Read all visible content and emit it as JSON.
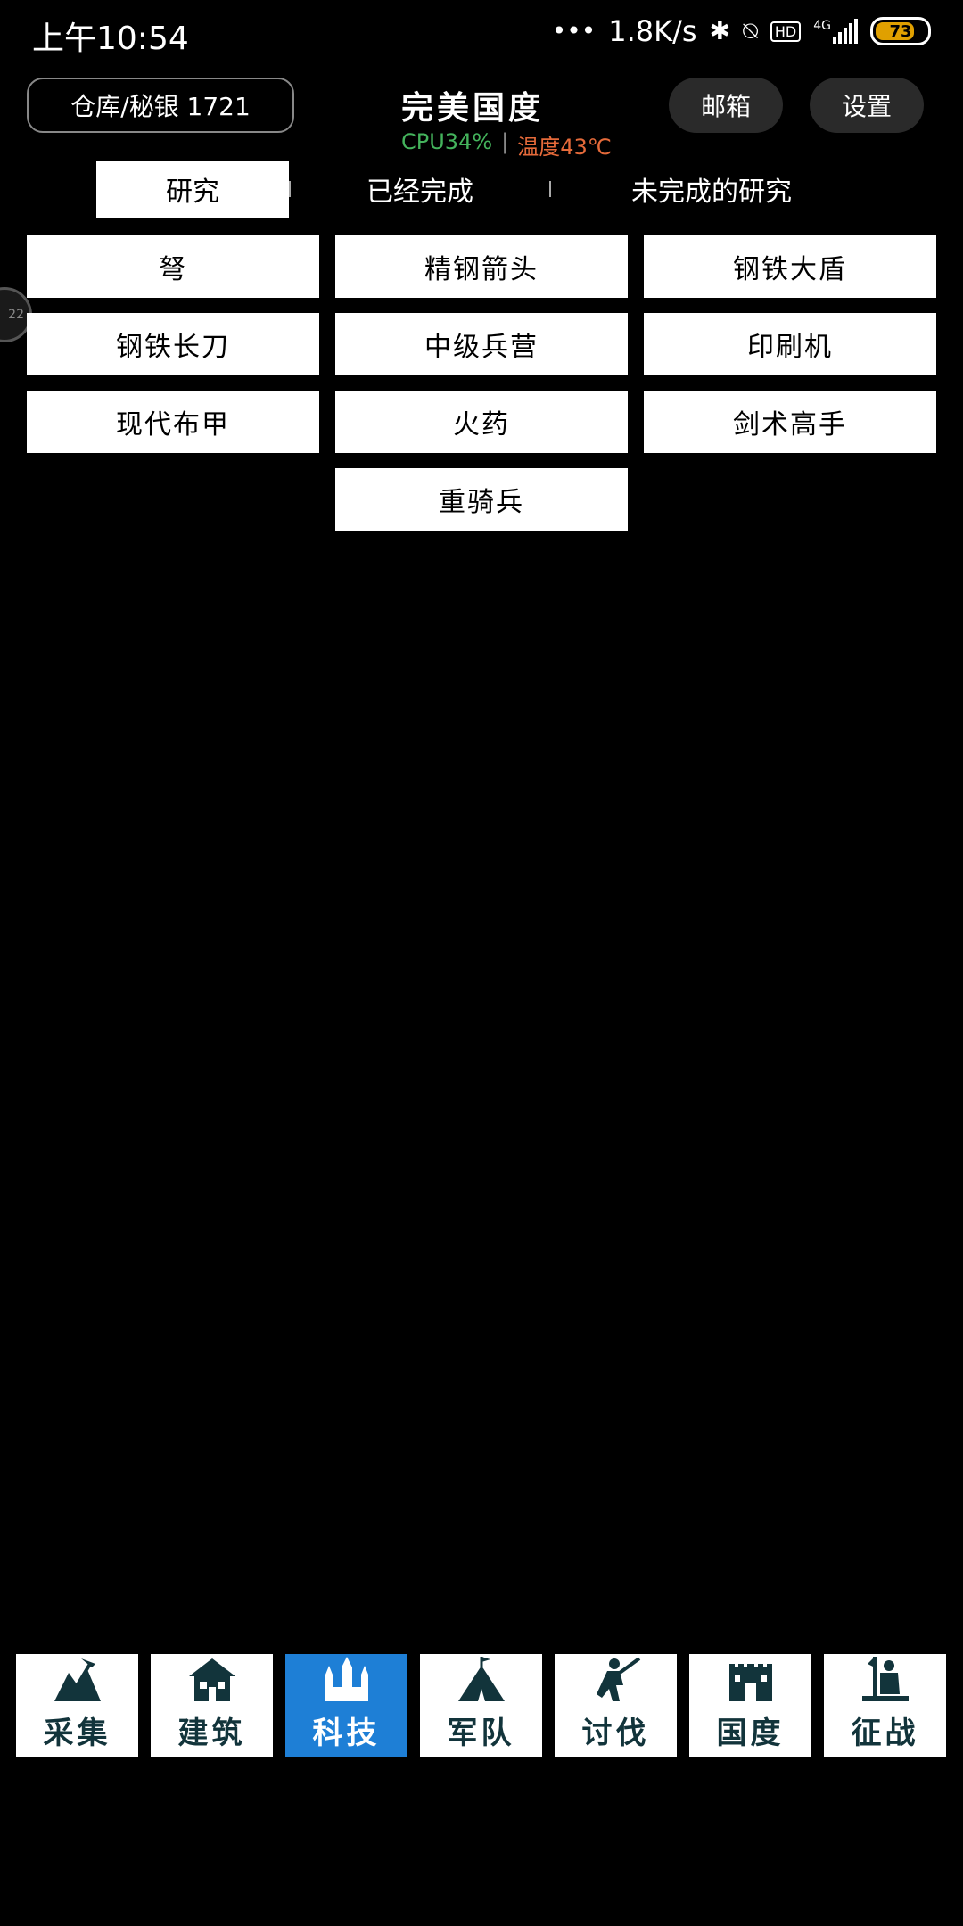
{
  "status_bar": {
    "time": "上午10:54",
    "net_speed": "1.8K/s",
    "signal_type": "4G",
    "battery": "73",
    "hd_badge": "HD"
  },
  "header": {
    "storage_label": "仓库/秘银 1721",
    "title": "完美国度",
    "cpu": "CPU34%",
    "separator": "|",
    "temperature": "温度43℃",
    "mail_label": "邮箱",
    "settings_label": "设置"
  },
  "floating_ball": {
    "text": "22"
  },
  "tabs": {
    "research": "研究",
    "completed": "已经完成",
    "unfinished": "未完成的研究"
  },
  "research_items": [
    "弩",
    "精钢箭头",
    "钢铁大盾",
    "钢铁长刀",
    "中级兵营",
    "印刷机",
    "现代布甲",
    "火药",
    "剑术高手",
    "重骑兵"
  ],
  "bottom_nav": {
    "items": [
      {
        "label": "采集",
        "icon": "gather-icon"
      },
      {
        "label": "建筑",
        "icon": "building-icon"
      },
      {
        "label": "科技",
        "icon": "tech-icon"
      },
      {
        "label": "军队",
        "icon": "army-icon"
      },
      {
        "label": "讨伐",
        "icon": "crusade-icon"
      },
      {
        "label": "国度",
        "icon": "kingdom-icon"
      },
      {
        "label": "征战",
        "icon": "conquest-icon"
      }
    ],
    "active_index": 2
  },
  "colors": {
    "background": "#000000",
    "cpu": "#44b35c",
    "temperature": "#e56a3a",
    "nav_active": "#1e7fd6",
    "nav_icon": "#12343b"
  }
}
